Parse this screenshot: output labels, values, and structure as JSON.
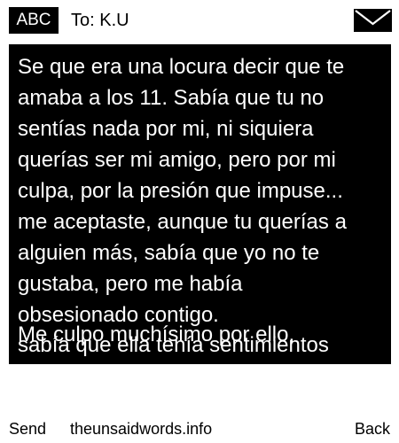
{
  "header": {
    "input_mode": "ABC",
    "recipient": "To: K.U",
    "icon": "envelope-icon"
  },
  "message": {
    "body": "Se que era una locura decir que te\namaba a los 11. Sabía que tu no\nsentías nada por mi, ni siquiera\nquerías ser mi amigo, pero por mi\nculpa, por la presión que impuse...\nme aceptaste, aunque tu querías a\nalguien más, sabía que yo no te\ngustaba, pero me había\nobsesionado contigo.",
    "overlap_line_1": "Me culpo muchísimo por ello,",
    "overlap_line_2": "sabía que ella tenía sentimientos"
  },
  "softkeys": {
    "left": "Send",
    "center": "theunsaidwords.info",
    "right": "Back"
  },
  "colors": {
    "background": "#ffffff",
    "message_background": "#000000",
    "message_text": "#ffffff"
  }
}
